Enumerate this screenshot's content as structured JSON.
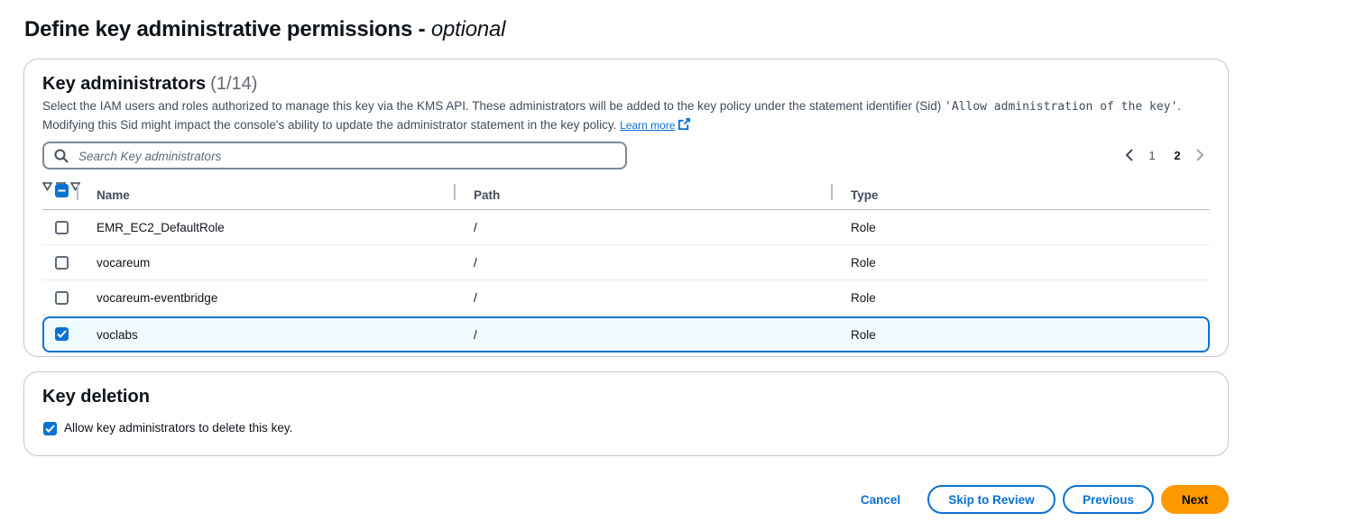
{
  "page": {
    "title": "Define key administrative permissions",
    "title_sep": " - ",
    "title_optional": "optional"
  },
  "admins": {
    "title": "Key administrators",
    "count": "(1/14)",
    "desc_part1": "Select the IAM users and roles authorized to manage this key via the KMS API. These administrators will be added to the key policy under the statement identifier (Sid) ",
    "desc_code": "'Allow administration of the key'",
    "desc_part2": ". Modifying this Sid might impact the console's ability to update the administrator statement in the key policy. ",
    "learn_more": "Learn more",
    "search_placeholder": "Search Key administrators",
    "pagination": {
      "pages": [
        "1",
        "2"
      ],
      "current": "2"
    },
    "columns": [
      "Name",
      "Path",
      "Type"
    ],
    "rows": [
      {
        "name": "EMR_EC2_DefaultRole",
        "path": "/",
        "type": "Role",
        "selected": false
      },
      {
        "name": "vocareum",
        "path": "/",
        "type": "Role",
        "selected": false
      },
      {
        "name": "vocareum-eventbridge",
        "path": "/",
        "type": "Role",
        "selected": false
      },
      {
        "name": "voclabs",
        "path": "/",
        "type": "Role",
        "selected": true
      }
    ]
  },
  "deletion": {
    "title": "Key deletion",
    "checkbox_label": "Allow key administrators to delete this key.",
    "checked": true
  },
  "footer": {
    "cancel": "Cancel",
    "skip": "Skip to Review",
    "previous": "Previous",
    "next": "Next"
  },
  "colors": {
    "accent": "#0972d3",
    "primary_button": "#ff9900",
    "selected_row_bg": "#f0fbff"
  }
}
